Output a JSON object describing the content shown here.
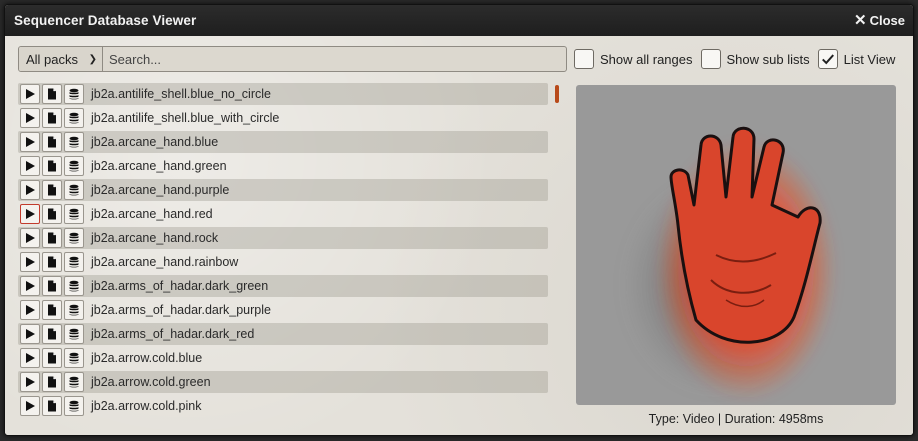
{
  "window": {
    "title": "Sequencer Database Viewer",
    "close_label": "Close"
  },
  "toolbar": {
    "pack_select": "All packs",
    "search_placeholder": "Search...",
    "search_value": "",
    "options": [
      {
        "label": "Show all ranges",
        "checked": false
      },
      {
        "label": "Show sub lists",
        "checked": false
      },
      {
        "label": "List View",
        "checked": true
      }
    ]
  },
  "entries": [
    {
      "name": "jb2a.antilife_shell.blue_no_circle"
    },
    {
      "name": "jb2a.antilife_shell.blue_with_circle"
    },
    {
      "name": "jb2a.arcane_hand.blue"
    },
    {
      "name": "jb2a.arcane_hand.green"
    },
    {
      "name": "jb2a.arcane_hand.purple"
    },
    {
      "name": "jb2a.arcane_hand.red",
      "playing": true
    },
    {
      "name": "jb2a.arcane_hand.rock"
    },
    {
      "name": "jb2a.arcane_hand.rainbow"
    },
    {
      "name": "jb2a.arms_of_hadar.dark_green"
    },
    {
      "name": "jb2a.arms_of_hadar.dark_purple"
    },
    {
      "name": "jb2a.arms_of_hadar.dark_red"
    },
    {
      "name": "jb2a.arrow.cold.blue"
    },
    {
      "name": "jb2a.arrow.cold.green"
    },
    {
      "name": "jb2a.arrow.cold.pink"
    }
  ],
  "preview": {
    "info": "Type: Video | Duration: 4958ms"
  },
  "colors": {
    "accent": "#c23b2c",
    "titlebar": "#242424",
    "scroll_thumb": "#b84a1a"
  },
  "icons": {
    "row_buttons": [
      "play-icon",
      "file-icon",
      "database-icon"
    ]
  }
}
